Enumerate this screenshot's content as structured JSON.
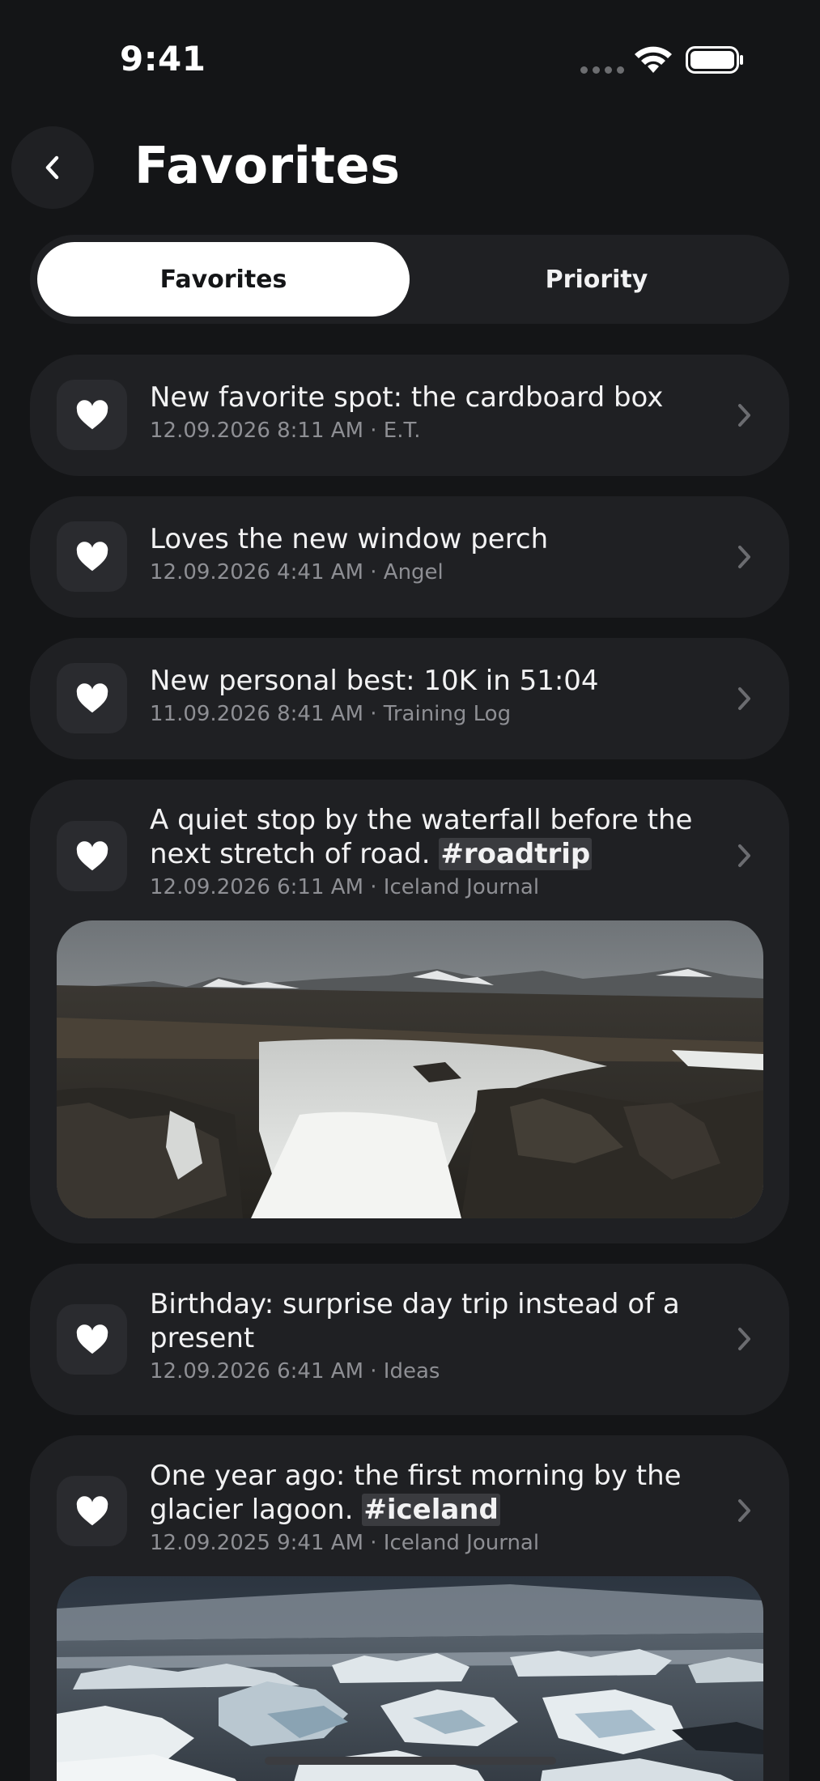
{
  "status": {
    "time": "9:41"
  },
  "header": {
    "title": "Favorites",
    "back_icon": "chevron-left-icon"
  },
  "tabs": [
    {
      "label": "Favorites",
      "active": true
    },
    {
      "label": "Priority",
      "active": false
    }
  ],
  "items": [
    {
      "title": "New favorite spot: the cardboard box",
      "meta": "12.09.2026 8:11 AM · E.T.",
      "icon": "heart-icon"
    },
    {
      "title": "Loves the new window perch",
      "meta": "12.09.2026 4:41 AM · Angel",
      "icon": "heart-icon"
    },
    {
      "title": "New personal best: 10K in 51:04",
      "meta": "11.09.2026 8:41 AM · Training Log",
      "icon": "heart-icon"
    },
    {
      "title_main": "A quiet stop by the waterfall before the next stretch of road.",
      "hashtag": "#roadtrip",
      "meta": "12.09.2026 6:11 AM · Iceland Journal",
      "icon": "heart-icon",
      "image": "waterfall-photo"
    },
    {
      "title": "Birthday: surprise day trip instead of a present",
      "meta": "12.09.2026 6:41 AM · Ideas",
      "icon": "heart-icon"
    },
    {
      "title_main": "One year ago: the first morning by the glacier lagoon.",
      "hashtag": "#iceland",
      "meta": "12.09.2025 9:41 AM · Iceland Journal",
      "icon": "heart-icon",
      "image": "glacier-lagoon-photo"
    }
  ],
  "colors": {
    "background": "#141517",
    "card": "#1f2023",
    "active_tab": "#ffffff",
    "meta_text": "#8e8f94"
  }
}
